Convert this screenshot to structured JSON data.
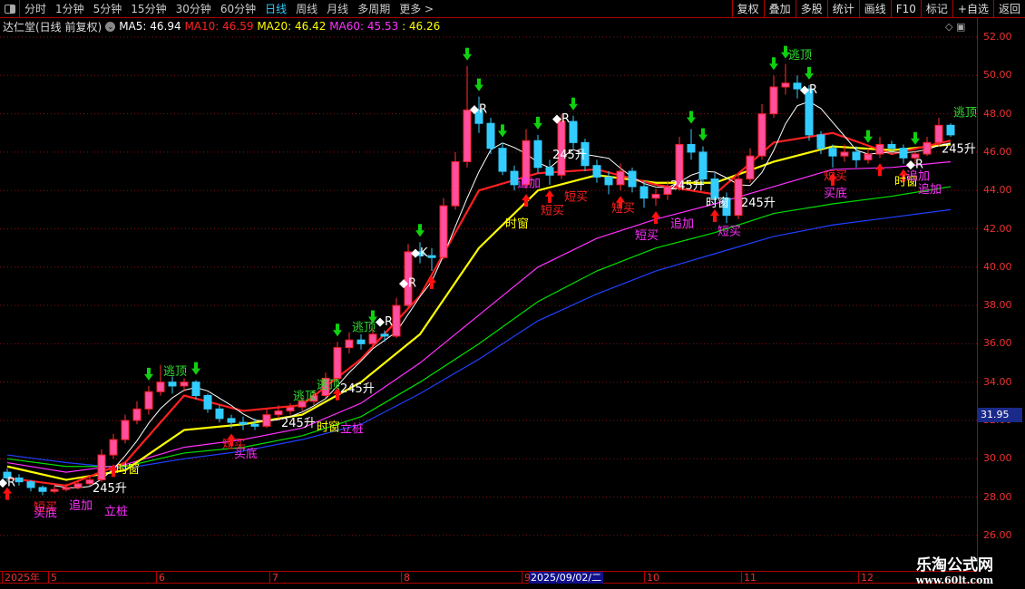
{
  "topbar": {
    "periods": [
      "分时",
      "1分钟",
      "5分钟",
      "15分钟",
      "30分钟",
      "60分钟",
      "日线",
      "周线",
      "月线",
      "多周期",
      "更多 >"
    ],
    "active": "日线",
    "buttons": [
      "复权",
      "叠加",
      "多股",
      "统计",
      "画线",
      "F10",
      "标记",
      "+自选",
      "返回"
    ]
  },
  "legend": {
    "title": "达仁堂(日线 前复权)",
    "ma5": "MA5: 46.94",
    "ma10": "MA10: 46.59",
    "ma20": "MA20: 46.42",
    "ma60": "MA60: 45.53",
    "extra": ": 46.26"
  },
  "colors": {
    "ma5": "#ffffff",
    "ma10": "#ff2020",
    "ma20": "#ffff00",
    "ma60": "#ff30ff",
    "line5": "#00e000",
    "line6": "#2040ff",
    "up": "#ff4fa0",
    "down": "#33ccff",
    "axis": "#f03030"
  },
  "current_price": "31.95",
  "xaxis": {
    "labels": [
      "2025年",
      "5",
      "6",
      "7",
      "8",
      "9",
      "10",
      "11",
      "12"
    ],
    "selected": "2025/09/02/二"
  },
  "logo": {
    "name": "乐淘公式网",
    "url": "www.60lt.com"
  },
  "chart_data": {
    "type": "candlestick",
    "ylim": [
      26,
      52
    ],
    "yticks": [
      "26.00",
      "28.00",
      "30.00",
      "32.00",
      "34.00",
      "36.00",
      "38.00",
      "40.00",
      "42.00",
      "44.00",
      "46.00",
      "48.00",
      "50.00",
      "52.00"
    ],
    "grid": true,
    "candles": [
      [
        29.3,
        29.5,
        28.8,
        29.0
      ],
      [
        29.0,
        29.2,
        28.6,
        28.8
      ],
      [
        28.8,
        28.9,
        28.3,
        28.5
      ],
      [
        28.5,
        28.6,
        28.1,
        28.3
      ],
      [
        28.3,
        28.6,
        28.2,
        28.4
      ],
      [
        28.4,
        28.7,
        28.3,
        28.5
      ],
      [
        28.5,
        28.9,
        28.4,
        28.7
      ],
      [
        28.7,
        29.1,
        28.6,
        28.9
      ],
      [
        28.9,
        30.5,
        28.8,
        30.2
      ],
      [
        30.2,
        31.3,
        30.0,
        31.0
      ],
      [
        31.0,
        32.3,
        30.8,
        32.0
      ],
      [
        32.0,
        33.0,
        31.8,
        32.6
      ],
      [
        32.6,
        33.8,
        32.3,
        33.5
      ],
      [
        33.5,
        34.9,
        33.3,
        34.0
      ],
      [
        34.0,
        34.3,
        33.4,
        33.8
      ],
      [
        33.8,
        34.2,
        33.5,
        34.0
      ],
      [
        34.0,
        34.1,
        33.1,
        33.3
      ],
      [
        33.3,
        33.4,
        32.4,
        32.6
      ],
      [
        32.6,
        32.8,
        31.9,
        32.1
      ],
      [
        32.1,
        32.3,
        31.6,
        31.9
      ],
      [
        31.9,
        32.2,
        31.5,
        31.8
      ],
      [
        31.8,
        32.1,
        31.5,
        31.7
      ],
      [
        31.7,
        32.6,
        31.6,
        32.3
      ],
      [
        32.3,
        32.8,
        32.1,
        32.5
      ],
      [
        32.5,
        32.9,
        32.3,
        32.7
      ],
      [
        32.7,
        33.2,
        32.5,
        33.0
      ],
      [
        33.0,
        33.6,
        32.8,
        33.3
      ],
      [
        33.3,
        34.5,
        33.2,
        34.2
      ],
      [
        34.2,
        36.1,
        34.0,
        35.8
      ],
      [
        35.8,
        36.6,
        35.5,
        36.2
      ],
      [
        36.2,
        36.5,
        35.7,
        36.0
      ],
      [
        36.0,
        36.8,
        35.8,
        36.5
      ],
      [
        36.5,
        36.7,
        36.1,
        36.4
      ],
      [
        36.4,
        38.4,
        36.3,
        38.0
      ],
      [
        38.0,
        41.2,
        37.9,
        40.8
      ],
      [
        40.8,
        41.3,
        40.2,
        40.6
      ],
      [
        40.6,
        41.0,
        39.8,
        40.5
      ],
      [
        40.5,
        43.6,
        40.4,
        43.2
      ],
      [
        43.2,
        46.0,
        43.0,
        45.5
      ],
      [
        45.5,
        50.5,
        45.2,
        48.2
      ],
      [
        48.2,
        48.9,
        47.0,
        47.5
      ],
      [
        47.5,
        47.8,
        45.9,
        46.2
      ],
      [
        46.2,
        46.5,
        44.8,
        45.0
      ],
      [
        45.0,
        45.3,
        44.0,
        44.3
      ],
      [
        44.3,
        47.2,
        44.1,
        46.6
      ],
      [
        46.6,
        46.9,
        44.9,
        45.2
      ],
      [
        45.2,
        45.6,
        44.3,
        44.8
      ],
      [
        44.8,
        48.0,
        44.6,
        47.6
      ],
      [
        47.6,
        47.9,
        46.2,
        46.5
      ],
      [
        46.5,
        46.7,
        45.0,
        45.3
      ],
      [
        45.3,
        45.6,
        44.4,
        44.7
      ],
      [
        44.7,
        45.0,
        43.8,
        44.3
      ],
      [
        44.3,
        45.4,
        44.0,
        45.0
      ],
      [
        45.0,
        45.2,
        43.9,
        44.2
      ],
      [
        44.2,
        44.5,
        43.1,
        43.6
      ],
      [
        43.6,
        44.1,
        43.2,
        43.8
      ],
      [
        43.8,
        44.5,
        43.5,
        44.2
      ],
      [
        44.2,
        46.8,
        44.0,
        46.4
      ],
      [
        46.4,
        47.2,
        45.6,
        46.0
      ],
      [
        46.0,
        46.3,
        44.3,
        44.6
      ],
      [
        44.6,
        44.9,
        43.3,
        43.6
      ],
      [
        43.6,
        43.9,
        42.3,
        42.7
      ],
      [
        42.7,
        44.9,
        42.5,
        44.6
      ],
      [
        44.6,
        46.2,
        44.4,
        45.8
      ],
      [
        45.8,
        48.5,
        45.6,
        48.0
      ],
      [
        48.0,
        50.0,
        47.8,
        49.4
      ],
      [
        49.4,
        50.6,
        49.0,
        49.6
      ],
      [
        49.6,
        50.0,
        48.8,
        49.3
      ],
      [
        49.3,
        49.5,
        46.6,
        46.9
      ],
      [
        46.9,
        47.1,
        45.9,
        46.2
      ],
      [
        46.2,
        46.4,
        45.2,
        45.8
      ],
      [
        45.8,
        46.4,
        45.5,
        46.0
      ],
      [
        46.0,
        46.3,
        45.2,
        45.6
      ],
      [
        45.6,
        46.2,
        45.4,
        45.9
      ],
      [
        45.9,
        46.8,
        45.7,
        46.4
      ],
      [
        46.4,
        46.6,
        45.9,
        46.2
      ],
      [
        46.2,
        46.4,
        45.4,
        45.7
      ],
      [
        45.7,
        46.1,
        45.4,
        45.9
      ],
      [
        45.9,
        46.8,
        45.8,
        46.5
      ],
      [
        46.5,
        47.8,
        46.3,
        47.4
      ],
      [
        47.4,
        47.5,
        46.8,
        46.9
      ]
    ],
    "ma_sample_step": 5,
    "lines": [
      {
        "name": "MA10",
        "color": "#ff2020",
        "values": [
          29.0,
          28.6,
          29.8,
          33.3,
          32.5,
          32.8,
          35.2,
          38.5,
          44.0,
          44.9,
          45.1,
          44.3,
          43.8,
          46.5,
          47.0,
          45.9,
          46.6
        ]
      },
      {
        "name": "MA20",
        "color": "#ffff00",
        "values": [
          29.6,
          28.9,
          29.4,
          31.5,
          31.8,
          32.3,
          34.0,
          36.5,
          41.0,
          44.0,
          44.8,
          44.4,
          44.4,
          45.5,
          46.3,
          46.1,
          46.4
        ]
      },
      {
        "name": "MA60",
        "color": "#ff30ff",
        "values": [
          29.8,
          29.3,
          29.7,
          30.6,
          31.0,
          31.6,
          32.9,
          35.0,
          37.5,
          40.0,
          41.5,
          42.5,
          43.3,
          44.2,
          45.1,
          45.2,
          45.5
        ]
      },
      {
        "color": "#00e000",
        "values": [
          30.0,
          29.6,
          29.6,
          30.3,
          30.6,
          31.2,
          32.2,
          34.0,
          36.0,
          38.2,
          39.8,
          41.0,
          41.8,
          42.8,
          43.3,
          43.7,
          44.2
        ]
      },
      {
        "color": "#2040ff",
        "values": [
          30.2,
          29.8,
          29.5,
          30.0,
          30.4,
          31.0,
          31.8,
          33.4,
          35.2,
          37.2,
          38.6,
          39.8,
          40.7,
          41.6,
          42.2,
          42.6,
          43.0
        ]
      }
    ],
    "annotations": [
      {
        "text": "逃顶",
        "i": 14,
        "p": 34.6,
        "color": "#30e030"
      },
      {
        "text": "逃顶",
        "i": 25,
        "p": 33.3,
        "color": "#30e030"
      },
      {
        "text": "逃顶",
        "i": 27,
        "p": 33.9,
        "color": "#30e030"
      },
      {
        "text": "逃顶",
        "i": 30,
        "p": 36.9,
        "color": "#30e030"
      },
      {
        "text": "逃顶",
        "i": 67,
        "p": 51.1,
        "color": "#30e030"
      },
      {
        "text": "逃顶",
        "i": 81,
        "p": 48.1,
        "color": "#30e030"
      },
      {
        "text": "短买",
        "i": 3,
        "p": 27.5,
        "color": "#ff2020"
      },
      {
        "text": "买底",
        "i": 3,
        "p": 27.2,
        "color": "#ff30ff"
      },
      {
        "text": "追加",
        "i": 6,
        "p": 27.6,
        "color": "#ff30ff"
      },
      {
        "text": "立桩",
        "i": 9,
        "p": 27.3,
        "color": "#ff30ff"
      },
      {
        "text": "时窗",
        "i": 10,
        "p": 29.5,
        "color": "#ffff00"
      },
      {
        "text": "245升",
        "i": 8,
        "p": 28.5,
        "color": "#ffffff"
      },
      {
        "text": "短买",
        "i": 19,
        "p": 30.8,
        "color": "#ff2020"
      },
      {
        "text": "买底",
        "i": 20,
        "p": 30.3,
        "color": "#ff30ff"
      },
      {
        "text": "245升",
        "i": 24,
        "p": 31.9,
        "color": "#ffffff"
      },
      {
        "text": "时窗",
        "i": 27,
        "p": 31.7,
        "color": "#ffff00"
      },
      {
        "text": "立桩",
        "i": 29,
        "p": 31.6,
        "color": "#ff30ff"
      },
      {
        "text": "245升",
        "i": 29,
        "p": 33.7,
        "color": "#ffffff"
      },
      {
        "text": "◆K",
        "i": 35,
        "p": 40.8,
        "color": "#ffffff"
      },
      {
        "text": "◆R",
        "i": 32,
        "p": 37.2,
        "color": "#ffffff"
      },
      {
        "text": "◆R",
        "i": 34,
        "p": 39.2,
        "color": "#ffffff"
      },
      {
        "text": "◆R",
        "i": 40,
        "p": 48.3,
        "color": "#ffffff"
      },
      {
        "text": "◆R",
        "i": 47,
        "p": 47.8,
        "color": "#ffffff"
      },
      {
        "text": "◆R",
        "i": 68,
        "p": 49.3,
        "color": "#ffffff"
      },
      {
        "text": "◆R",
        "i": 77,
        "p": 45.4,
        "color": "#ffffff"
      },
      {
        "text": "◆R",
        "i": 0,
        "p": 28.8,
        "color": "#ffffff"
      },
      {
        "text": "245升",
        "i": 47,
        "p": 45.9,
        "color": "#ffffff"
      },
      {
        "text": "追加",
        "i": 44,
        "p": 44.4,
        "color": "#ff30ff"
      },
      {
        "text": "短买",
        "i": 46,
        "p": 43.0,
        "color": "#ff2020"
      },
      {
        "text": "时窗",
        "i": 43,
        "p": 42.3,
        "color": "#ffff00"
      },
      {
        "text": "短买",
        "i": 48,
        "p": 43.7,
        "color": "#ff2020"
      },
      {
        "text": "短买",
        "i": 52,
        "p": 43.1,
        "color": "#ff2020"
      },
      {
        "text": "短买",
        "i": 54,
        "p": 41.7,
        "color": "#ff30ff"
      },
      {
        "text": "追加",
        "i": 57,
        "p": 42.3,
        "color": "#ff30ff"
      },
      {
        "text": "245升",
        "i": 57,
        "p": 44.3,
        "color": "#ffffff"
      },
      {
        "text": "时窗",
        "i": 60,
        "p": 43.4,
        "color": "#ffffff"
      },
      {
        "text": "短买",
        "i": 61,
        "p": 41.9,
        "color": "#ff30ff"
      },
      {
        "text": "245升",
        "i": 63,
        "p": 43.4,
        "color": "#ffffff"
      },
      {
        "text": "短买",
        "i": 70,
        "p": 44.8,
        "color": "#ff2020"
      },
      {
        "text": "买底",
        "i": 70,
        "p": 43.9,
        "color": "#ff30ff"
      },
      {
        "text": "时窗",
        "i": 76,
        "p": 44.5,
        "color": "#ffff00"
      },
      {
        "text": "追加",
        "i": 77,
        "p": 44.8,
        "color": "#ff30ff"
      },
      {
        "text": "追加",
        "i": 78,
        "p": 44.1,
        "color": "#ff30ff"
      },
      {
        "text": "245升",
        "i": 80,
        "p": 46.2,
        "color": "#ffffff"
      }
    ],
    "up_arrows": [
      0,
      9,
      19,
      28,
      36,
      44,
      46,
      52,
      55,
      60,
      70,
      74,
      76
    ],
    "down_arrows": [
      12,
      16,
      28,
      31,
      35,
      39,
      40,
      42,
      45,
      48,
      58,
      59,
      65,
      66,
      68,
      73,
      77
    ]
  }
}
